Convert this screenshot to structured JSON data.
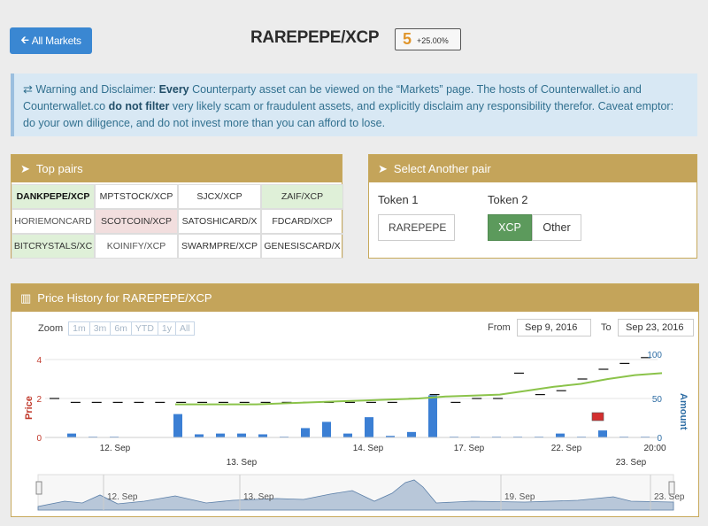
{
  "header": {
    "back_button": "All Markets",
    "title": "RAREPEPE/XCP",
    "price": "5",
    "change": "+25.00%"
  },
  "warning": {
    "icon": "exchange-icon",
    "lead": "Warning and Disclaimer:",
    "every": "Every",
    "text1": "Counterparty asset can be viewed on the “Markets” page. The hosts of Counterwallet.io and Counterwallet.co",
    "do_not_filter": "do not filter",
    "text2": "very likely scam or fraudulent assets, and explicitly disclaim any responsibility therefor. Caveat emptor: do your own diligence, and do not invest more than you can afford to lose."
  },
  "top_pairs": {
    "title": "Top pairs",
    "icon": "rocket-icon",
    "cells": [
      {
        "label": "DANKPEPE/XCP",
        "style": "green bold"
      },
      {
        "label": "MPTSTOCK/XCP",
        "style": ""
      },
      {
        "label": "SJCX/XCP",
        "style": ""
      },
      {
        "label": "ZAIF/XCP",
        "style": "green"
      },
      {
        "label": "HORIEMONCARD",
        "style": "gray"
      },
      {
        "label": "SCOTCOIN/XCP",
        "style": "red"
      },
      {
        "label": "SATOSHICARD/X",
        "style": ""
      },
      {
        "label": "FDCARD/XCP",
        "style": ""
      },
      {
        "label": "BITCRYSTALS/XC",
        "style": "green"
      },
      {
        "label": "KOINIFY/XCP",
        "style": "gray"
      },
      {
        "label": "SWARMPRE/XCP",
        "style": ""
      },
      {
        "label": "GENESISCARD/X",
        "style": ""
      }
    ]
  },
  "select_pair": {
    "title": "Select Another pair",
    "icon": "rocket-icon",
    "token1_label": "Token 1",
    "token2_label": "Token 2",
    "token1_value": "RAREPEPE",
    "token2_active": "XCP",
    "token2_other": "Other"
  },
  "price_history": {
    "title": "Price History for RAREPEPE/XCP",
    "icon": "bar-chart-icon",
    "zoom_label": "Zoom",
    "zoom_options": [
      "1m",
      "3m",
      "6m",
      "YTD",
      "1y",
      "All"
    ],
    "from_label": "From",
    "from_value": "Sep 9, 2016",
    "to_label": "To",
    "to_value": "Sep 23, 2016"
  },
  "chart_data": {
    "type": "bar",
    "ylabel_left": "Price",
    "ylabel_right": "Amount",
    "left_ticks": [
      "4",
      "2",
      "0"
    ],
    "right_ticks": [
      "100",
      "50",
      "0"
    ],
    "ylim_price": [
      0,
      4
    ],
    "ylim_amount": [
      0,
      100
    ],
    "x_ticks_upper": [
      "12. Sep",
      "14. Sep",
      "17. Sep",
      "22. Sep",
      "20:00"
    ],
    "x_ticks_lower": [
      "13. Sep",
      "23. Sep"
    ],
    "navigator_ticks": [
      "12. Sep",
      "13. Sep",
      "19. Sep",
      "23. Sep"
    ],
    "volume_bars": [
      5,
      1,
      1,
      0,
      0,
      30,
      4,
      5,
      5,
      4,
      1,
      12,
      20,
      5,
      26,
      2,
      7,
      54,
      1,
      1,
      1,
      1,
      1,
      5,
      1,
      9,
      1,
      1
    ],
    "price_ticks": [
      2.0,
      1.8,
      1.8,
      1.8,
      1.8,
      1.8,
      1.8,
      1.8,
      1.8,
      1.8,
      1.8,
      1.8,
      1.8,
      1.8,
      1.8,
      1.8,
      1.8,
      2.0,
      2.2,
      1.8,
      2.0,
      2.0,
      3.3,
      2.2,
      2.4,
      3.0,
      3.5,
      3.8,
      4.1
    ],
    "moving_average": [
      1.7,
      1.7,
      1.7,
      1.7,
      1.75,
      1.8,
      1.85,
      1.9,
      1.95,
      2.0,
      2.1,
      2.15,
      2.2,
      2.4,
      2.6,
      2.75,
      3.0,
      3.2,
      3.3
    ]
  }
}
